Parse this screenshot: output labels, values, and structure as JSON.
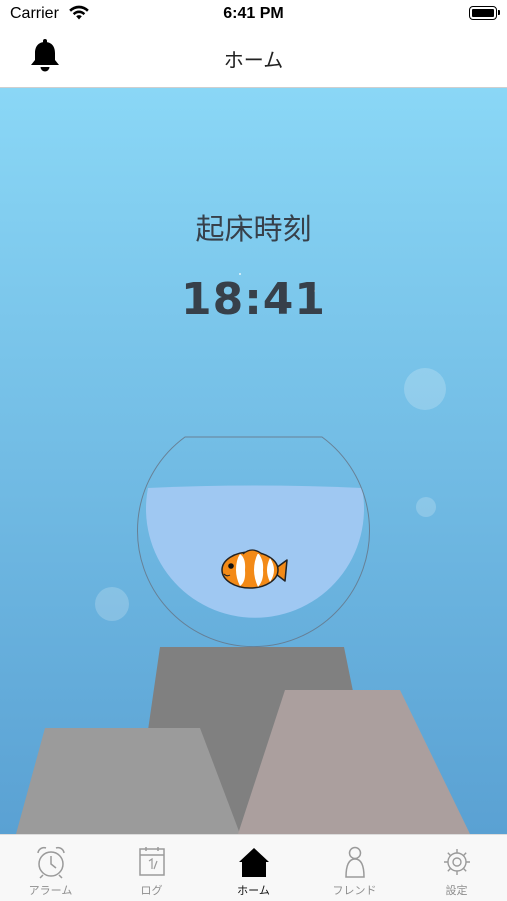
{
  "status_bar": {
    "carrier": "Carrier",
    "time": "6:41 PM",
    "wifi_icon": "wifi-icon",
    "battery_icon": "battery-icon"
  },
  "nav": {
    "title": "ホーム",
    "left_icon": "bell-icon"
  },
  "main": {
    "label": "起床時刻",
    "wake_time": "18:41"
  },
  "tabs": [
    {
      "label": "アラーム",
      "icon": "alarm-clock-icon",
      "active": false
    },
    {
      "label": "ログ",
      "icon": "calendar-icon",
      "active": false
    },
    {
      "label": "ホーム",
      "icon": "home-icon",
      "active": true
    },
    {
      "label": "フレンド",
      "icon": "person-icon",
      "active": false
    },
    {
      "label": "設定",
      "icon": "gear-icon",
      "active": false
    }
  ],
  "colors": {
    "sky_top": "#8ad7f6",
    "sky_bottom": "#5aa1d3",
    "text": "#37404a",
    "active_tab": "#111111",
    "inactive_tab": "#8e8e8e"
  }
}
